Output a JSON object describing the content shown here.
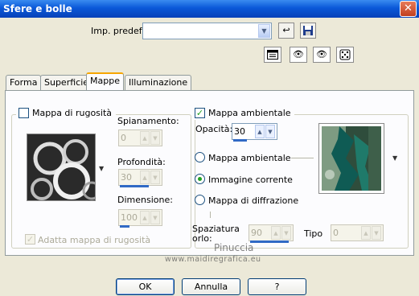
{
  "window": {
    "title": "Sfere e bolle",
    "close_glyph": "✕"
  },
  "preset": {
    "label": "Imp. predef.:",
    "value": ""
  },
  "tabs": [
    {
      "label": "Forma"
    },
    {
      "label": "Superficie"
    },
    {
      "label": "Mappe",
      "active": true
    },
    {
      "label": "Illuminazione"
    }
  ],
  "bump_map": {
    "checkbox_label": "Mappa di rugosità",
    "checked": false,
    "spianamento_label": "Spianamento:",
    "spianamento_value": "0",
    "profondita_label": "Profondità:",
    "profondita_value": "30",
    "dimensione_label": "Dimensione:",
    "dimensione_value": "100",
    "fit_label": "Adatta mappa di rugosità",
    "fit_checked": true
  },
  "env_map": {
    "checkbox_label": "Mappa ambientale",
    "checked": true,
    "opacity_label": "Opacità:",
    "opacity_value": "30",
    "radio_options": [
      {
        "label": "Mappa ambientale",
        "selected": false
      },
      {
        "label": "Immagine corrente",
        "selected": true
      },
      {
        "label": "Mappa di diffrazione",
        "selected": false
      }
    ],
    "spacing_label_line1": "Spaziatura",
    "spacing_label_line2": "orlo:",
    "spacing_value": "90",
    "type_label": "Tipo",
    "type_value": "0"
  },
  "watermark": {
    "line1": "Pinuccia",
    "line2": "www.maidiregrafica.eu"
  },
  "buttons": {
    "ok": "OK",
    "cancel": "Annulla",
    "help": "?"
  },
  "icons": {
    "save_preset": "save-icon",
    "load_preset": "arrow-icon",
    "randomize": "dice-icon"
  }
}
